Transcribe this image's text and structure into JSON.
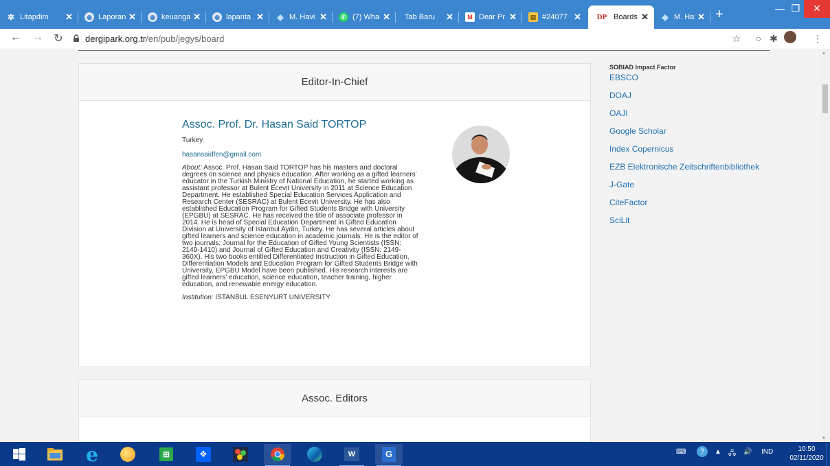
{
  "browser": {
    "tabs": [
      {
        "label": "Litapdim",
        "icon": "gear-icon"
      },
      {
        "label": "Laporan",
        "icon": "globe-icon"
      },
      {
        "label": "keuanga",
        "icon": "globe-icon"
      },
      {
        "label": "lapanta",
        "icon": "globe-icon"
      },
      {
        "label": "M. Havi",
        "icon": "bird-icon"
      },
      {
        "label": "(7) Wha",
        "icon": "whatsapp-icon"
      },
      {
        "label": "Tab Baru",
        "icon": ""
      },
      {
        "label": "Dear Pr",
        "icon": "gmail-icon"
      },
      {
        "label": "#24077",
        "icon": "folder-icon"
      },
      {
        "label": "Boards",
        "icon": "dergipark-icon"
      },
      {
        "label": "M. Havi",
        "icon": "bird-icon"
      }
    ],
    "active_tab_index": 9,
    "dp_badge": "DP",
    "url_host": "dergipark.org.tr",
    "url_path": "/en/pub/jegys/board"
  },
  "cards": [
    {
      "title": "Editor-In-Chief"
    },
    {
      "title": "Assoc. Editors"
    }
  ],
  "editor": {
    "name": "Assoc. Prof. Dr. Hasan Said TORTOP",
    "country": "Turkey",
    "email": "hasansaidfen@gmail.com",
    "about_label": "About:",
    "about_lines": [
      " Assoc. Prof. Hasan Said TORTOP has his masters and doctoral",
      "degrees on science and physics education. After working as a gifted learners'",
      "educator in the Turkish Ministry of National Education, he started working as",
      "assistant professor at Bulent Ecevit University in 2011 at Science Education",
      "Department. He established Special Education Services Application and",
      "Research Center (SESRAC) at Bulent Ecevit University. He has also",
      "established Education Program for Gifted Students Bridge with University",
      "(EPGBU) at SESRAC. He has received the title of associate professor in",
      "2014. He is head of Special Education Department in Gifted Education",
      "Division at University of Istanbul Aydin, Turkey. He has several articles about",
      "gifted learners and science education in academic journals. He is the editor of",
      "two journals; Journal for the Education of Gifted Young Scientists (ISSN:",
      "2149-1410) and Journal of Gifted Education and Creativity (ISSN: 2149-",
      "360X). His two books entitled Differentiated Instruction in Gifted Education,",
      "Differentiation Models and Education Program for Gifted Students Bridge with",
      "University, EPGBU Model have been published. His research interests are",
      "gifted learners' education, science education, teacher training, higher",
      "education, and renewable energy education."
    ],
    "institution_label": "Institution:",
    "institution": " ISTANBUL ESENYURT UNIVERSITY"
  },
  "sidebar": {
    "title": "SOBIAD Impact Factor",
    "links": [
      "EBSCO",
      "DOAJ",
      "OAJI",
      "Google Scholar",
      "Index Copernicus",
      "EZB Elektronische Zeitschriftenbibliothek",
      "J-Gate",
      "CiteFactor",
      "SciLit"
    ]
  },
  "taskbar": {
    "tray_lang": "IND",
    "time": "10:50",
    "date": "02/11/2020"
  },
  "colors": {
    "tab_strip": "#3c86cf",
    "link": "#1e6fb2",
    "name": "#1e6c93",
    "taskbar": "#0b3a8a"
  }
}
